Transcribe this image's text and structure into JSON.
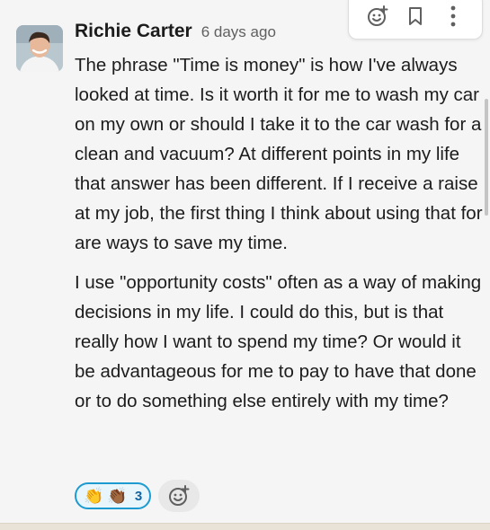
{
  "previous_message": {
    "clipped_text": ""
  },
  "actions": {
    "add_reaction_icon": "add-reaction-icon",
    "bookmark_icon": "bookmark-icon",
    "more_icon": "more-actions-icon"
  },
  "message": {
    "author": "Richie Carter",
    "timestamp": "6 days ago",
    "paragraphs": [
      "The phrase \"Time is money\" is how I've always looked at time.  Is it worth it for me to wash my car on my own or should I take it to the car wash for a clean and vacuum?  At different points in my life that answer has been different.  If I receive a raise at my job, the first thing I think about using that for are ways to save my time.",
      "I use \"opportunity costs\" often as a way of making decisions in my life. I could do this, but is that really how I want to spend my time? Or would it be advantageous for me to pay to have that done or to do something else entirely with my time?"
    ]
  },
  "reactions": [
    {
      "emojis": [
        "👏",
        "👏🏾"
      ],
      "count": "3"
    }
  ],
  "colors": {
    "reaction_border": "#1d9bd1",
    "reaction_bg": "#e8f5fa",
    "reaction_count": "#1264a3"
  }
}
